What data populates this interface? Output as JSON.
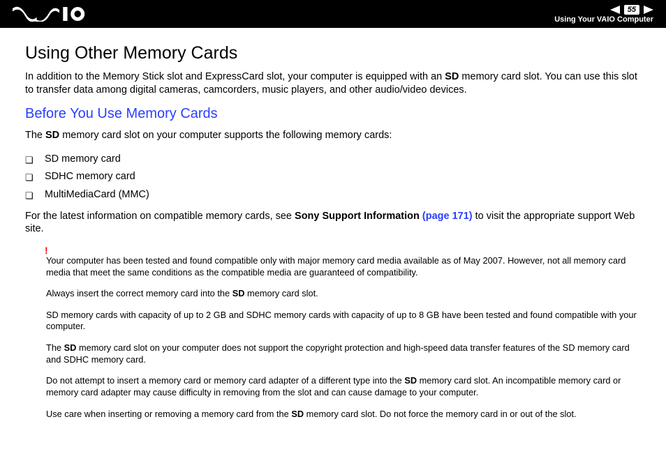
{
  "header": {
    "page_number": "55",
    "section": "Using Your VAIO Computer"
  },
  "content": {
    "h1": "Using Other Memory Cards",
    "intro_a": "In addition to the Memory Stick slot and ExpressCard slot, your computer is equipped with an ",
    "intro_bold": "SD",
    "intro_b": " memory card slot. You can use this slot to transfer data among digital cameras, camcorders, music players, and other audio/video devices.",
    "h2": "Before You Use Memory Cards",
    "supports_a": "The ",
    "supports_bold": "SD",
    "supports_b": " memory card slot on your computer supports the following memory cards:",
    "bullets": {
      "0": "SD memory card",
      "1": "SDHC memory card",
      "2": "MultiMediaCard (MMC)"
    },
    "latest_a": "For the latest information on compatible memory cards, see ",
    "latest_bold": "Sony Support Information ",
    "latest_link": "(page 171)",
    "latest_b": " to visit the appropriate support Web site.",
    "notes": {
      "excl": "!",
      "n0": "Your computer has been tested and found compatible only with major memory card media available as of May 2007. However, not all memory card media that meet the same conditions as the compatible media are guaranteed of compatibility.",
      "n1_a": "Always insert the correct memory card into the ",
      "n1_bold": "SD",
      "n1_b": " memory card slot.",
      "n2": "SD memory cards with capacity of up to 2 GB and SDHC memory cards with capacity of up to 8 GB have been tested and found compatible with your computer.",
      "n3_a": "The ",
      "n3_bold": "SD",
      "n3_b": " memory card slot on your computer does not support the copyright protection and high-speed data transfer features of the SD memory card and SDHC memory card.",
      "n4_a": "Do not attempt to insert a memory card or memory card adapter of a different type into the ",
      "n4_bold": "SD",
      "n4_b": " memory card slot. An incompatible memory card or memory card adapter may cause difficulty in removing from the slot and can cause damage to your computer.",
      "n5_a": "Use care when inserting or removing a memory card from the ",
      "n5_bold": "SD",
      "n5_b": " memory card slot. Do not force the memory card in or out of the slot."
    }
  }
}
